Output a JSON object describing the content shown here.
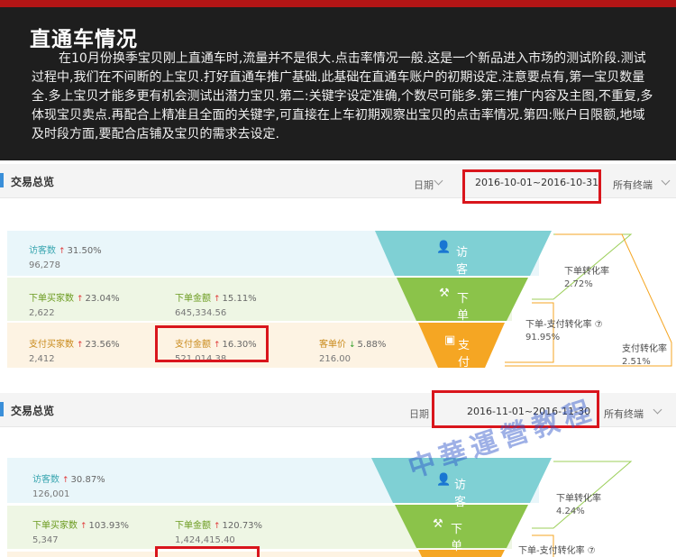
{
  "banner": {
    "title": "直通车情况",
    "body": "在10月份换季宝贝刚上直通车时,流量并不是很大.点击率情况一般.这是一个新品进入市场的测试阶段.测试过程中,我们在不间断的上宝贝.打好直通车推广基础.此基础在直通车账户的初期设定.注意要点有,第一宝贝数量全.多上宝贝才能多更有机会测试出潜力宝贝.第二:关键字设定准确,个数尽可能多.第三推广内容及主图,不重复,多体现宝贝卖点.再配合上精准且全面的关键字,可直接在上车初期观察出宝贝的点击率情况.第四:账户日限额,地域及时段方面,要配合店铺及宝贝的需求去设定."
  },
  "panel1": {
    "title": "交易总览",
    "date_label": "日期",
    "date_range": "2016-10-01~2016-10-31",
    "terminal": "所有终端",
    "visitors": {
      "name": "访客数",
      "arrow": "↑",
      "pct": "31.50%",
      "value": "96,278"
    },
    "buyers_order": {
      "name": "下单买家数",
      "arrow": "↑",
      "pct": "23.04%",
      "value": "2,622"
    },
    "amount_order": {
      "name": "下单金额",
      "arrow": "↑",
      "pct": "15.11%",
      "value": "645,334.56"
    },
    "buyers_pay": {
      "name": "支付买家数",
      "arrow": "↑",
      "pct": "23.56%",
      "value": "2,412"
    },
    "amount_pay": {
      "name": "支付金额",
      "arrow": "↑",
      "pct": "16.30%",
      "value": "521,014.38"
    },
    "unit_price": {
      "name": "客单价",
      "arrow": "↓",
      "pct": "5.88%",
      "value": "216.00"
    },
    "funnel": {
      "visit": "访客",
      "order": "下单",
      "pay": "支付"
    },
    "rates": {
      "order_rate": {
        "name": "下单转化率",
        "value": "2.72%"
      },
      "order_pay_rate": {
        "name": "下单-支付转化率 ⑦",
        "value": "91.95%"
      },
      "pay_rate": {
        "name": "支付转化率",
        "value": "2.51%"
      }
    }
  },
  "panel2": {
    "title": "交易总览",
    "date_label": "日期",
    "date_range": "2016-11-01~2016-11-30",
    "terminal": "所有终端",
    "visitors": {
      "name": "访客数",
      "arrow": "↑",
      "pct": "30.87%",
      "value": "126,001"
    },
    "buyers_order": {
      "name": "下单买家数",
      "arrow": "↑",
      "pct": "103.93%",
      "value": "5,347"
    },
    "amount_order": {
      "name": "下单金额",
      "arrow": "↑",
      "pct": "120.73%",
      "value": "1,424,415.40"
    },
    "funnel": {
      "visit": "访客",
      "order": "下单"
    },
    "rates": {
      "order_rate": {
        "name": "下单转化率",
        "value": "4.24%"
      },
      "order_pay_rate": {
        "name": "下单-支付转化率 ⑦"
      }
    }
  },
  "watermark": "中華運營教程",
  "colors": {
    "banner_bg": "#1e1e1e",
    "banner_top_line": "#b31515",
    "highlight_box": "#d9151c",
    "funnel_visit": "#7fd0d4",
    "funnel_order": "#8bc34a",
    "funnel_pay": "#f5a623"
  }
}
